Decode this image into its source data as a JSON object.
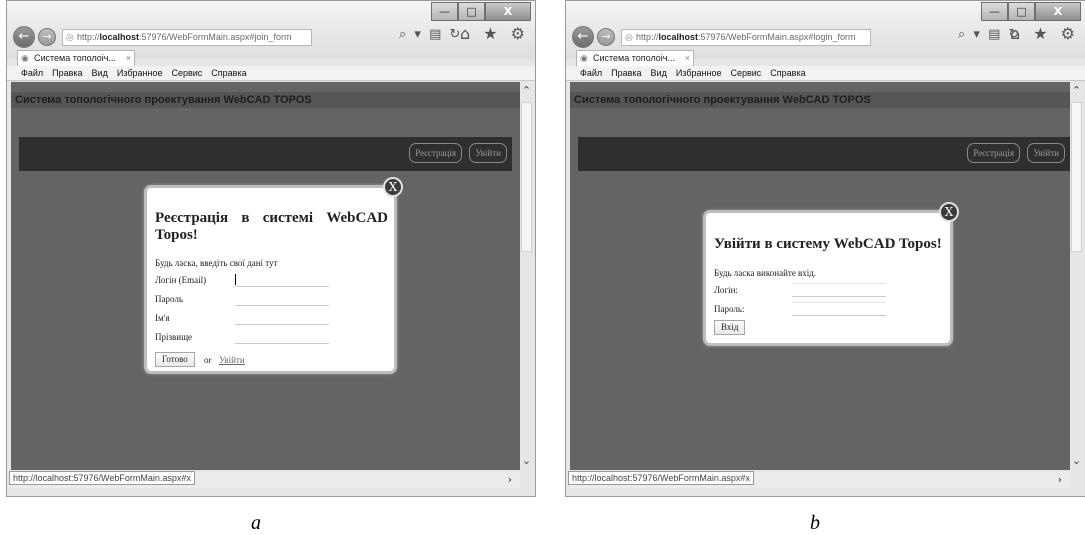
{
  "shots": [
    {
      "window_buttons": {
        "minimize": "—",
        "maximize": "□",
        "close": "X"
      },
      "address": {
        "prefix": "http://",
        "host": "localhost",
        "path": ":57976/WebFormMain.aspx#join_form"
      },
      "address_tools": "⌕ ▾ ▤ ↻",
      "browser_tools": "⌂ ★ ⚙",
      "tab_title": "Система тополоіч...",
      "tab_close": "×",
      "menu": [
        "Файл",
        "Правка",
        "Вид",
        "Избранное",
        "Сервис",
        "Справка"
      ],
      "site_title": "Система топологічного проектування WebCAD TOPOS",
      "header_buttons": {
        "register": "Реєстрація",
        "login": "Увійти"
      },
      "status_url": "http://localhost:57976/WebFormMain.aspx#x",
      "modal": {
        "close_label": "X",
        "title": "Реєстрація в системі WebCAD Topos!",
        "hint": "Будь ласка, введіть свої дані тут",
        "fields": [
          {
            "label": "Логін (Email)",
            "value": ""
          },
          {
            "label": "Пароль",
            "value": ""
          },
          {
            "label": "Ім'я",
            "value": ""
          },
          {
            "label": "Прізвище",
            "value": ""
          }
        ],
        "submit": "Готово",
        "or_text": "or",
        "alt_link": "Увійти"
      },
      "caption": "a"
    },
    {
      "window_buttons": {
        "minimize": "—",
        "maximize": "□",
        "close": "X"
      },
      "address": {
        "prefix": "http://",
        "host": "localhost",
        "path": ":57976/WebFormMain.aspx#login_form"
      },
      "address_tools": "⌕ ▾ ▤ ↻",
      "browser_tools": "⌂ ★ ⚙",
      "tab_title": "Система тополоіч...",
      "tab_close": "×",
      "menu": [
        "Файл",
        "Правка",
        "Вид",
        "Избранное",
        "Сервис",
        "Справка"
      ],
      "site_title": "Система топологічного проектування WebCAD TOPOS",
      "header_buttons": {
        "register": "Реєстрація",
        "login": "Увійти"
      },
      "status_url": "http://localhost:57976/WebFormMain.aspx#x",
      "modal": {
        "close_label": "X",
        "title": "Увійти в систему WebCAD Topos!",
        "hint": "Будь ласка виконайте вхід.",
        "fields": [
          {
            "label": "Логін:",
            "value": ""
          },
          {
            "label": "Пароль:",
            "value": ""
          }
        ],
        "submit": "Вхід"
      },
      "caption": "b"
    }
  ]
}
